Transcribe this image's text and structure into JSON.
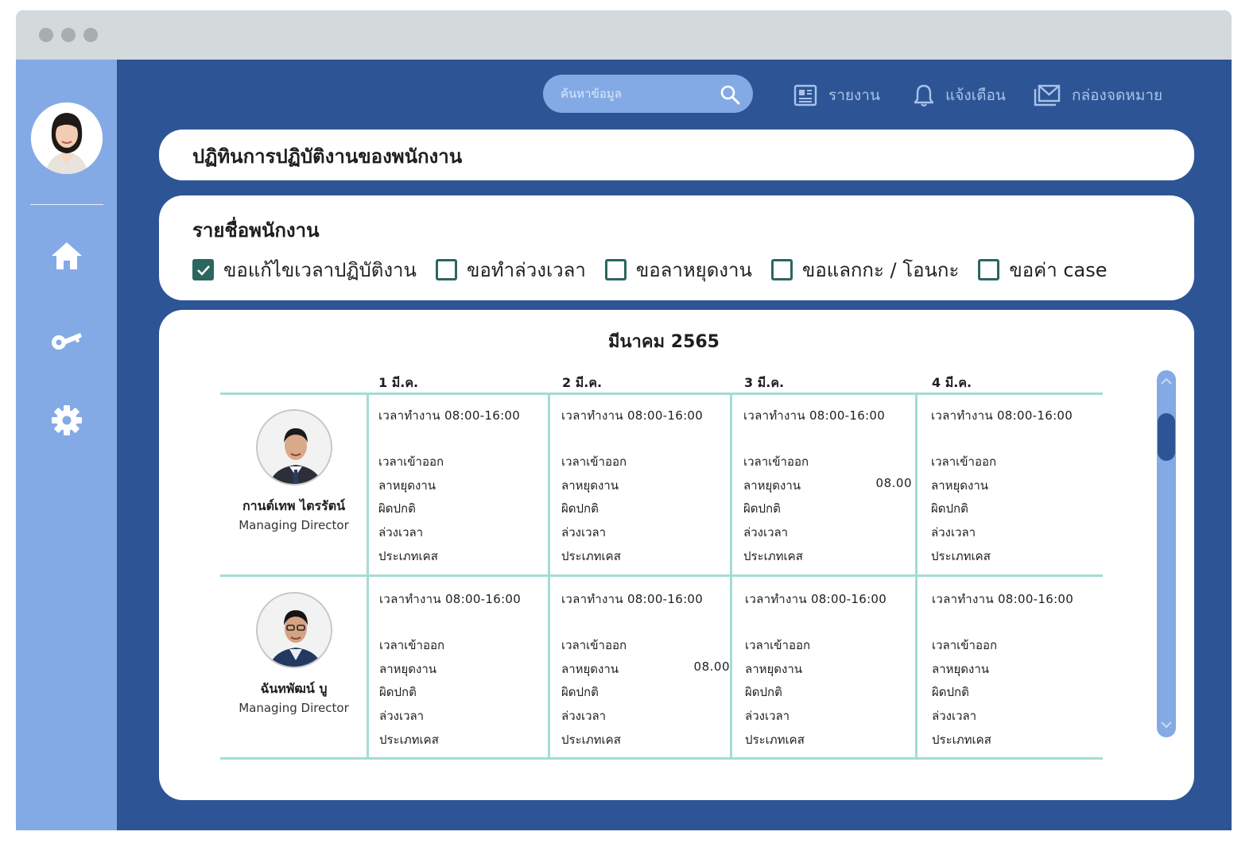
{
  "search": {
    "placeholder": "ค้นหาข้อมูล"
  },
  "nav": {
    "report": "รายงาน",
    "notify": "แจ้งเตือน",
    "mailbox": "กล่องจดหมาย"
  },
  "page_title": "ปฏิทินการปฏิบัติงานของพนักงาน",
  "filters": {
    "title": "รายชื่อพนักงาน",
    "items": [
      {
        "label": "ขอแก้ไขเวลาปฏิบัติงาน",
        "checked": true
      },
      {
        "label": "ขอทำล่วงเวลา",
        "checked": false
      },
      {
        "label": "ขอลาหยุดงาน",
        "checked": false
      },
      {
        "label": "ขอแลกกะ / โอนกะ",
        "checked": false
      },
      {
        "label": "ขอค่า case",
        "checked": false
      }
    ]
  },
  "calendar": {
    "month": "มีนาคม 2565",
    "days": [
      "1 มี.ค.",
      "2 มี.ค.",
      "3 มี.ค.",
      "4 มี.ค."
    ],
    "row_labels": [
      "เวลาเข้าออก",
      "ลาหยุดงาน",
      "ผิดปกติ",
      "ล่วงเวลา",
      "ประเภทเคส"
    ],
    "employees": [
      {
        "name": "กานต์เทพ ไตรรัตน์",
        "role": "Managing Director",
        "cells": [
          {
            "work": "เวลาทำงาน 08:00-16:00",
            "leave_value": ""
          },
          {
            "work": "เวลาทำงาน 08:00-16:00",
            "leave_value": ""
          },
          {
            "work": "เวลาทำงาน 08:00-16:00",
            "leave_value": "08.00"
          },
          {
            "work": "เวลาทำงาน 08:00-16:00",
            "leave_value": ""
          }
        ]
      },
      {
        "name": "ฉันทพัฒน์ บู",
        "role": "Managing Director",
        "cells": [
          {
            "work": "เวลาทำงาน 08:00-16:00",
            "leave_value": ""
          },
          {
            "work": "เวลาทำงาน 08:00-16:00",
            "leave_value": "08.00"
          },
          {
            "work": "เวลาทำงาน 08:00-16:00",
            "leave_value": ""
          },
          {
            "work": "เวลาทำงาน 08:00-16:00",
            "leave_value": ""
          }
        ]
      }
    ]
  },
  "colors": {
    "background": "#2d5595",
    "sidebar": "#84aae6",
    "accent_teal": "#2b6660",
    "grid_line": "#a3dcd4"
  },
  "icons": {
    "sidebar": [
      "home-icon",
      "key-icon",
      "gear-icon"
    ],
    "nav": [
      "report-icon",
      "bell-icon",
      "mail-icon"
    ]
  }
}
